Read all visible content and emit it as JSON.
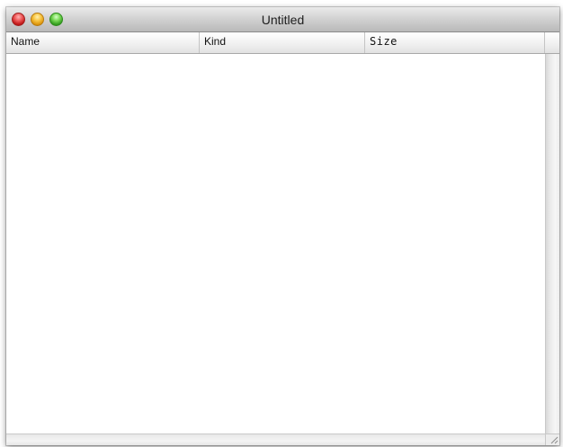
{
  "window": {
    "title": "Untitled",
    "buttons": [
      {
        "name": "close",
        "icon": "close-icon",
        "color": "#e04848"
      },
      {
        "name": "minimize",
        "icon": "minimize-icon",
        "color": "#f3b432"
      },
      {
        "name": "zoom",
        "icon": "zoom-icon",
        "color": "#5cc43e"
      }
    ]
  },
  "table": {
    "columns": [
      {
        "label": "Name"
      },
      {
        "label": "Kind"
      },
      {
        "label": "Size"
      }
    ],
    "rows": []
  },
  "icons": {
    "resize_grip": "resize-grip-icon"
  }
}
